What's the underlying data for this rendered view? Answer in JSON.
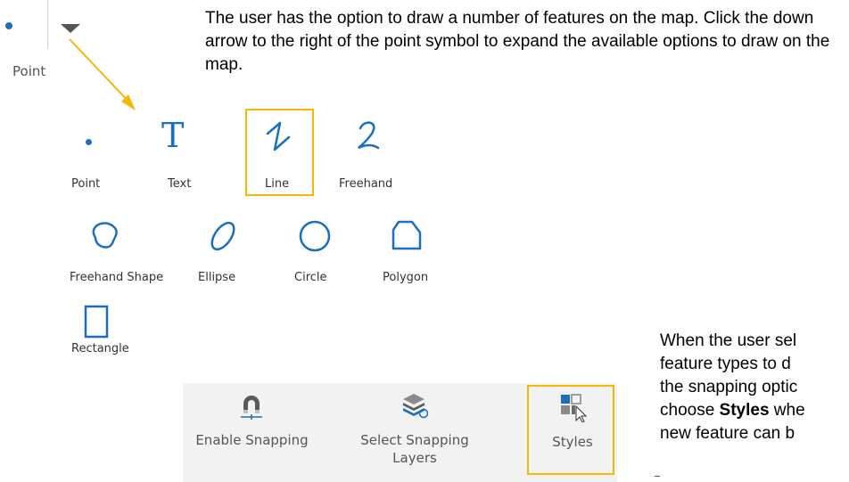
{
  "top_tool": {
    "label": "Point"
  },
  "intro_text": "The user has the option to draw a number of features on the map.  Click the down arrow to the right of the point symbol to expand the available options to draw on the map.",
  "tools": {
    "point": "Point",
    "text": "Text",
    "line": "Line",
    "freehand": "Freehand",
    "freehand_shape": "Freehand Shape",
    "ellipse": "Ellipse",
    "circle": "Circle",
    "polygon": "Polygon",
    "rectangle": "Rectangle"
  },
  "snapping": {
    "enable": "Enable Snapping",
    "select_line1": "Select Snapping",
    "select_line2": "Layers",
    "styles": "Styles"
  },
  "note": {
    "line1": "When the user sel",
    "line2": "feature types to d",
    "line3": "the snapping optic",
    "line4_pre": "choose ",
    "line4_bold": "Styles",
    "line4_post": " whe",
    "line5": "new feature can b"
  },
  "colors": {
    "accent": "#1a6fbf",
    "highlight": "#f5b800",
    "arrow": "#f5b800"
  },
  "icons": [
    "point-icon",
    "text-icon",
    "line-icon",
    "freehand-icon",
    "freehand-shape-icon",
    "ellipse-icon",
    "circle-icon",
    "polygon-icon",
    "rectangle-icon",
    "magnet-icon",
    "layers-icon",
    "styles-icon",
    "chevron-down-icon"
  ]
}
